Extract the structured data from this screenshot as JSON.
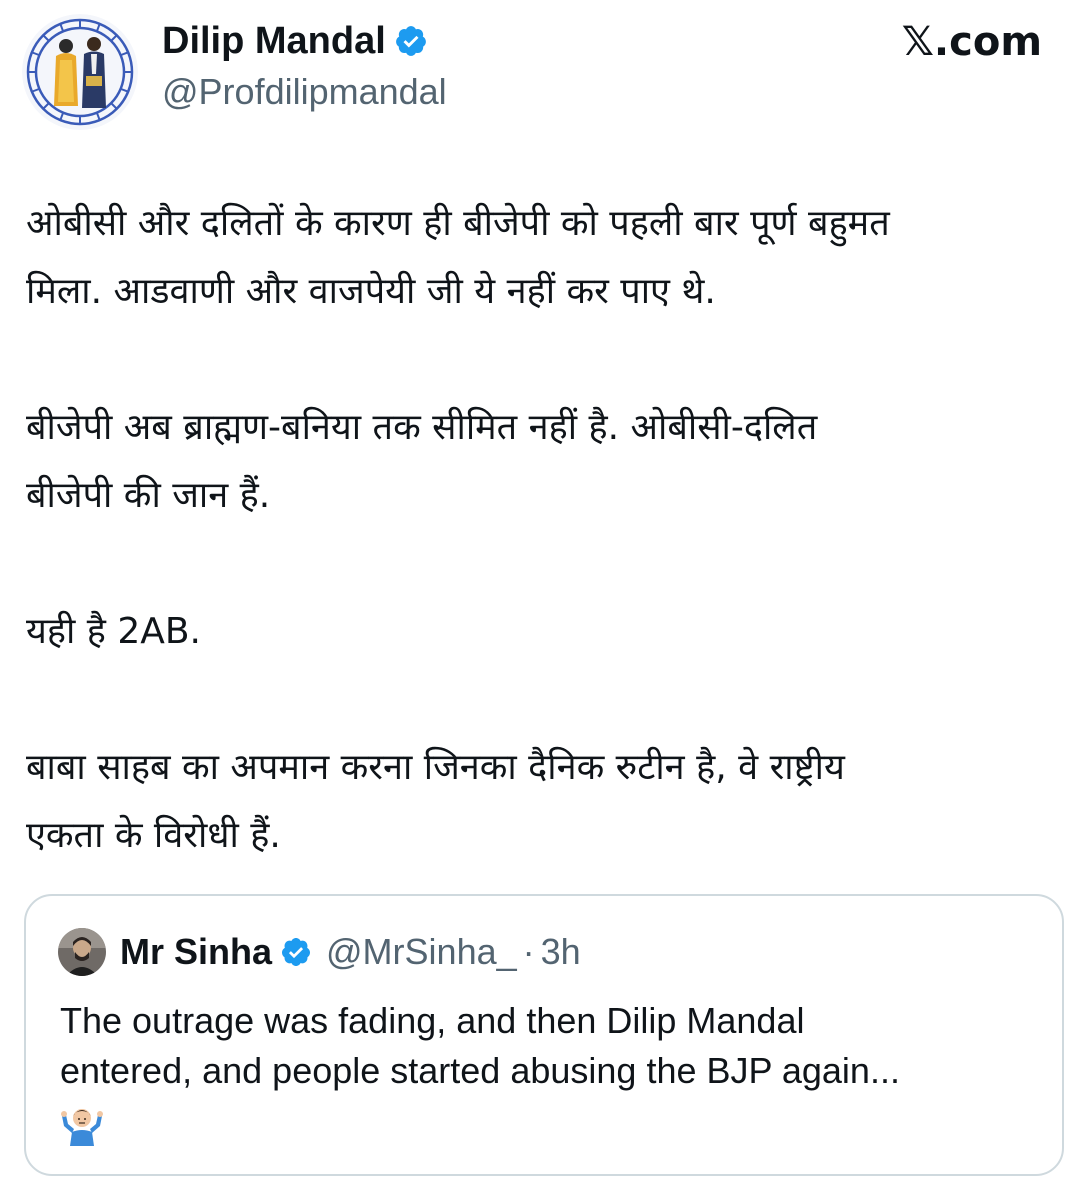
{
  "author": {
    "name": "Dilip Mandal",
    "handle": "@Profdilipmandal",
    "verified": true,
    "avatar": "ambedkar-buddha-avatar"
  },
  "site": {
    "label": "𝕏.com"
  },
  "tweet": {
    "paragraphs": [
      {
        "lines": [
          "ओबीसी और दलितों के कारण ही बीजेपी को पहली बार पूर्ण बहुमत",
          "मिला. आडवाणी और वाजपेयी जी ये नहीं कर पाए थे."
        ]
      },
      {
        "lines": [
          "बीजेपी अब ब्राह्मण-बनिया तक सीमित नहीं है. ओबीसी-दलित",
          "बीजेपी की जान हैं."
        ]
      },
      {
        "lines": [
          "यही है 2AB."
        ]
      },
      {
        "lines": [
          "बाबा साहब का अपमान करना जिनका दैनिक रुटीन है, वे राष्ट्रीय",
          "एकता के विरोधी हैं."
        ]
      }
    ]
  },
  "quoted_tweet": {
    "name": "Mr Sinha",
    "handle": "@MrSinha_",
    "separator": "·",
    "time": "3h",
    "verified": true,
    "text_lines": [
      "The outrage was fading, and then Dilip Mandal",
      "entered, and people started abusing the BJP again..."
    ],
    "emoji": "person-shrugging-emoji"
  },
  "colors": {
    "text": "#0f1419",
    "secondary": "#536471",
    "verified_blue": "#1d9bf0",
    "border": "#cfd9de"
  }
}
